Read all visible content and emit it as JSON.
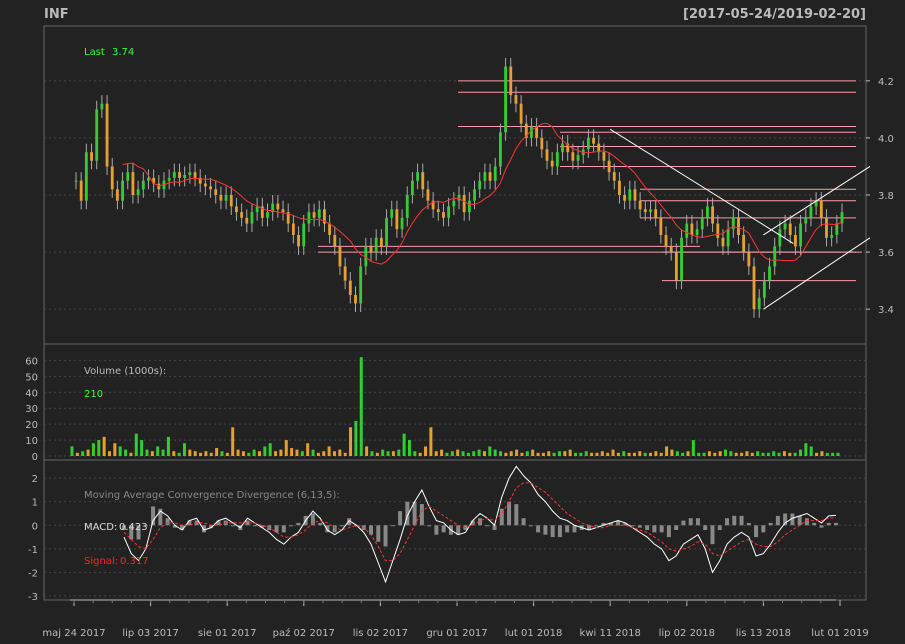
{
  "header": {
    "symbol": "INF",
    "date_range": "[2017-05-24/2019-02-20]"
  },
  "colors": {
    "background": "#222222",
    "panel_border": "#666666",
    "grid": "#444444",
    "axis_text": "#bbbbbb",
    "up": "#33cc33",
    "down": "#e69f31",
    "ma": "#ff3333",
    "hline": "#ff99aa",
    "trendline": "#ffffff",
    "legend_green": "#33ff33",
    "legend_red": "#ff2222",
    "macd_hist": "#888888"
  },
  "chart_data": [
    {
      "type": "candlestick",
      "name": "price",
      "legend": {
        "label": "Last",
        "value": "3.74"
      },
      "y_ticks": [
        "3.4",
        "3.6",
        "3.8",
        "4.0",
        "4.2"
      ],
      "ylim": [
        3.32,
        4.35
      ],
      "x_tick_labels": [
        "maj 24 2017",
        "lip 03 2017",
        "sie 01 2017",
        "paź 02 2017",
        "lis 02 2017",
        "gru 01 2017",
        "lut 01 2018",
        "kwi 11 2018",
        "lip 02 2018",
        "lis 13 2018",
        "lut 01 2019"
      ],
      "close": [
        3.85,
        3.78,
        3.95,
        3.92,
        4.1,
        4.12,
        3.9,
        3.82,
        3.78,
        3.85,
        3.88,
        3.8,
        3.82,
        3.85,
        3.86,
        3.84,
        3.82,
        3.85,
        3.86,
        3.88,
        3.86,
        3.87,
        3.88,
        3.86,
        3.84,
        3.83,
        3.82,
        3.8,
        3.78,
        3.8,
        3.76,
        3.74,
        3.72,
        3.7,
        3.74,
        3.76,
        3.72,
        3.74,
        3.77,
        3.75,
        3.74,
        3.7,
        3.66,
        3.62,
        3.7,
        3.74,
        3.72,
        3.75,
        3.7,
        3.66,
        3.62,
        3.55,
        3.5,
        3.45,
        3.42,
        3.55,
        3.62,
        3.6,
        3.65,
        3.62,
        3.72,
        3.75,
        3.68,
        3.72,
        3.8,
        3.85,
        3.88,
        3.82,
        3.78,
        3.75,
        3.74,
        3.72,
        3.76,
        3.78,
        3.8,
        3.74,
        3.78,
        3.82,
        3.85,
        3.88,
        3.85,
        3.9,
        4.02,
        4.25,
        4.15,
        4.12,
        4.05,
        4.0,
        4.04,
        4.0,
        3.96,
        3.92,
        3.9,
        3.95,
        3.98,
        3.95,
        3.92,
        3.94,
        3.96,
        4.0,
        3.98,
        3.95,
        3.92,
        3.88,
        3.85,
        3.8,
        3.78,
        3.82,
        3.78,
        3.75,
        3.74,
        3.75,
        3.72,
        3.66,
        3.62,
        3.6,
        3.5,
        3.65,
        3.7,
        3.66,
        3.68,
        3.72,
        3.76,
        3.7,
        3.65,
        3.62,
        3.68,
        3.72,
        3.66,
        3.6,
        3.55,
        3.4,
        3.44,
        3.5,
        3.55,
        3.62,
        3.68,
        3.7,
        3.66,
        3.62,
        3.7,
        3.72,
        3.76,
        3.78,
        3.72,
        3.65,
        3.66,
        3.7,
        3.74
      ],
      "moving_average": {
        "period": 10,
        "color": "#ff3333"
      },
      "horizontal_lines": [
        4.2,
        4.16,
        4.04,
        4.02,
        3.97,
        3.9,
        3.82,
        3.78,
        3.72,
        3.62,
        3.6,
        3.5
      ],
      "trendlines": [
        {
          "from": [
            "kwi 11 2018",
            4.03
          ],
          "to": [
            "lis 13 2018",
            3.63
          ]
        },
        {
          "from": [
            "lis 13 2018",
            3.4
          ],
          "to": [
            "lut 01 2019",
            3.65
          ]
        },
        {
          "from": [
            "lis 13 2018",
            3.66
          ],
          "to": [
            "lut 01 2019",
            3.9
          ]
        }
      ]
    },
    {
      "type": "bar",
      "name": "volume",
      "legend": {
        "label": "Volume (1000s):",
        "value": "210"
      },
      "y_ticks": [
        "0",
        "10",
        "20",
        "30",
        "40",
        "50",
        "60"
      ],
      "ylim": [
        0,
        64
      ],
      "values": [
        6,
        2,
        3,
        4,
        8,
        10,
        12,
        3,
        8,
        6,
        4,
        2,
        14,
        10,
        4,
        3,
        6,
        4,
        12,
        3,
        2,
        8,
        4,
        3,
        2,
        3,
        2,
        5,
        3,
        2,
        18,
        4,
        3,
        2,
        4,
        3,
        6,
        8,
        3,
        4,
        10,
        5,
        4,
        3,
        8,
        4,
        2,
        3,
        6,
        3,
        4,
        2,
        18,
        22,
        62,
        6,
        3,
        2,
        4,
        3,
        3,
        4,
        14,
        10,
        3,
        2,
        6,
        18,
        3,
        4,
        2,
        3,
        4,
        3,
        2,
        3,
        4,
        3,
        6,
        4,
        3,
        2,
        3,
        4,
        2,
        3,
        4,
        2,
        2,
        3,
        2,
        3,
        3,
        4,
        2,
        2,
        3,
        2,
        2,
        3,
        2,
        4,
        2,
        3,
        2,
        2,
        3,
        2,
        2,
        3,
        2,
        6,
        4,
        3,
        2,
        3,
        10,
        2,
        2,
        3,
        2,
        3,
        4,
        3,
        2,
        2,
        3,
        2,
        3,
        2,
        2,
        3,
        2,
        3,
        2,
        2,
        4,
        8,
        6,
        2,
        3,
        2,
        2,
        2
      ]
    },
    {
      "type": "line",
      "name": "macd",
      "title": "Moving Average Convergence Divergence (6,13,5):",
      "legend": [
        {
          "label": "MACD:",
          "value": "0.423"
        },
        {
          "label": "Signal:",
          "value": "0.317"
        }
      ],
      "y_ticks": [
        "-3",
        "-2",
        "-1",
        "0",
        "1",
        "2"
      ],
      "ylim": [
        -3,
        2.6
      ],
      "macd": [
        -0.5,
        -1.2,
        -1.5,
        -1.0,
        0.2,
        0.6,
        0.4,
        0.0,
        -0.2,
        0.2,
        0.3,
        -0.2,
        -0.1,
        0.2,
        0.3,
        0.1,
        -0.1,
        0.3,
        0.1,
        -0.1,
        -0.3,
        -0.6,
        -0.8,
        -0.5,
        -0.3,
        0.2,
        0.6,
        0.3,
        -0.2,
        -0.4,
        -0.2,
        0.2,
        0.0,
        -0.3,
        -0.8,
        -1.6,
        -2.4,
        -1.5,
        -0.6,
        0.4,
        1.0,
        1.5,
        0.8,
        0.2,
        0.1,
        -0.2,
        -0.4,
        -0.3,
        0.2,
        0.5,
        0.3,
        0.0,
        1.2,
        2.0,
        2.5,
        2.1,
        1.8,
        1.3,
        1.0,
        0.6,
        0.3,
        0.2,
        0.0,
        -0.1,
        -0.2,
        -0.1,
        0.0,
        0.1,
        0.2,
        0.1,
        -0.1,
        -0.3,
        -0.5,
        -0.8,
        -1.0,
        -1.5,
        -1.3,
        -0.8,
        -0.6,
        -0.4,
        -1.0,
        -2.0,
        -1.5,
        -0.8,
        -0.5,
        -0.3,
        -0.5,
        -1.3,
        -1.2,
        -0.8,
        -0.3,
        0.1,
        0.3,
        0.4,
        0.5,
        0.3,
        0.1,
        0.4,
        0.42
      ],
      "signal": [
        -0.3,
        -0.6,
        -0.9,
        -1.0,
        -0.6,
        -0.1,
        0.1,
        0.1,
        0.0,
        0.0,
        0.1,
        0.1,
        0.0,
        0.0,
        0.1,
        0.1,
        0.1,
        0.1,
        0.1,
        0.0,
        -0.1,
        -0.3,
        -0.5,
        -0.5,
        -0.4,
        -0.2,
        0.1,
        0.2,
        0.1,
        -0.1,
        -0.2,
        -0.1,
        0.0,
        -0.1,
        -0.4,
        -0.9,
        -1.5,
        -1.5,
        -1.2,
        -0.6,
        0.0,
        0.6,
        0.8,
        0.6,
        0.4,
        0.2,
        0.0,
        -0.1,
        0.0,
        0.2,
        0.3,
        0.2,
        0.5,
        1.0,
        1.6,
        1.8,
        1.8,
        1.6,
        1.4,
        1.1,
        0.8,
        0.5,
        0.3,
        0.1,
        0.0,
        -0.1,
        -0.1,
        0.0,
        0.0,
        0.0,
        -0.1,
        -0.2,
        -0.3,
        -0.5,
        -0.7,
        -1.0,
        -1.1,
        -1.0,
        -0.9,
        -0.7,
        -0.8,
        -1.2,
        -1.3,
        -1.1,
        -0.9,
        -0.7,
        -0.6,
        -0.8,
        -0.9,
        -0.9,
        -0.7,
        -0.4,
        -0.2,
        0.0,
        0.2,
        0.2,
        0.2,
        0.3,
        0.317
      ]
    }
  ]
}
